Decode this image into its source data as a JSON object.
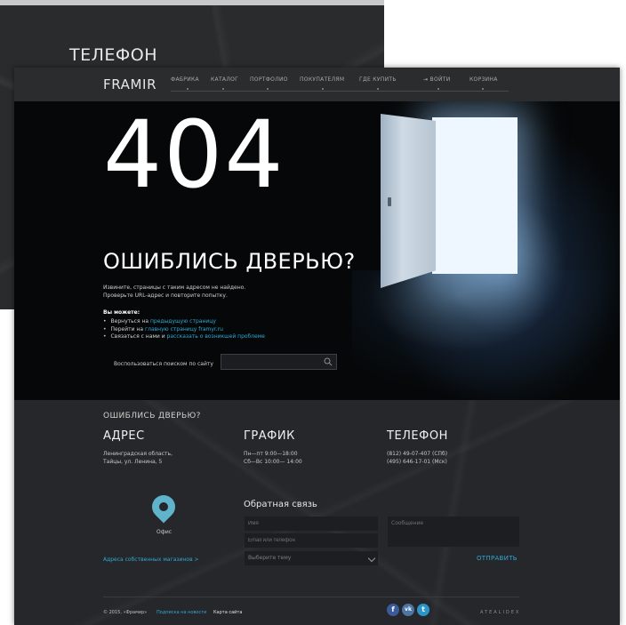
{
  "back_window": {
    "title": "ТЕЛЕФОН"
  },
  "nav": {
    "logo": "FRAMIR",
    "items": [
      "ФАБРИКА",
      "КАТАЛОГ",
      "ПОРТФОЛИО",
      "ПОКУПАТЕЛЯМ",
      "ГДЕ КУПИТЬ"
    ],
    "login": "ВОЙТИ",
    "cart": "КОРЗИНА"
  },
  "hero": {
    "code": "404",
    "headline": "ОШИБЛИСЬ ДВЕРЬЮ?",
    "sub_line1": "Извините, страницы с таким адресом не найдено.",
    "sub_line2": "Проверьте URL-адрес и повторите попытку.",
    "can_title": "Вы можете:",
    "options": [
      {
        "prefix": "Вернуться на ",
        "link": "предыдущую страницу"
      },
      {
        "prefix": "Перейти на ",
        "link": "главную страницу framyr.ru"
      },
      {
        "prefix": "Связаться с нами и ",
        "link": "рассказать о возникшей проблеме"
      }
    ],
    "search_label": "Воспользоваться поиском по сайту",
    "search_placeholder": ""
  },
  "contacts": {
    "kicker": "ОШИБЛИСЬ ДВЕРЬЮ?",
    "address_title": "АДРЕС",
    "address_line1": "Ленинградская область,",
    "address_line2": "Тайцы, ул. Ленина, 5",
    "schedule_title": "ГРАФИК",
    "schedule_line1": "Пн—пт 9:00—18:00",
    "schedule_line2": "Сб—Вс 10:00— 14:00",
    "phone_title": "ТЕЛЕФОН",
    "phone_line1": "(812) 49-07-407 (СПб)",
    "phone_line2": "(495) 646-17-01 (Мск)",
    "office_label": "Офис",
    "stores_link": "Адреса собственных магазинов  >"
  },
  "feedback": {
    "title": "Обратная связь",
    "name_placeholder": "Имя",
    "contact_placeholder": "Email или телефон",
    "topic_placeholder": "Выберите тему",
    "message_placeholder": "Сообщение",
    "send_label": "ОТПРАВИТЬ"
  },
  "footer": {
    "copyright": "© 2015, «Фрамир»",
    "news_link": "Подписка на новости",
    "sitemap_link": "Карта сайта",
    "social": [
      "f",
      "vk",
      "t"
    ],
    "developer": "ATEALIDEX"
  },
  "colors": {
    "accent": "#2ea9d6",
    "pin": "#5fb4cc",
    "hero_bg": "#050708",
    "page_bg": "#262729"
  }
}
